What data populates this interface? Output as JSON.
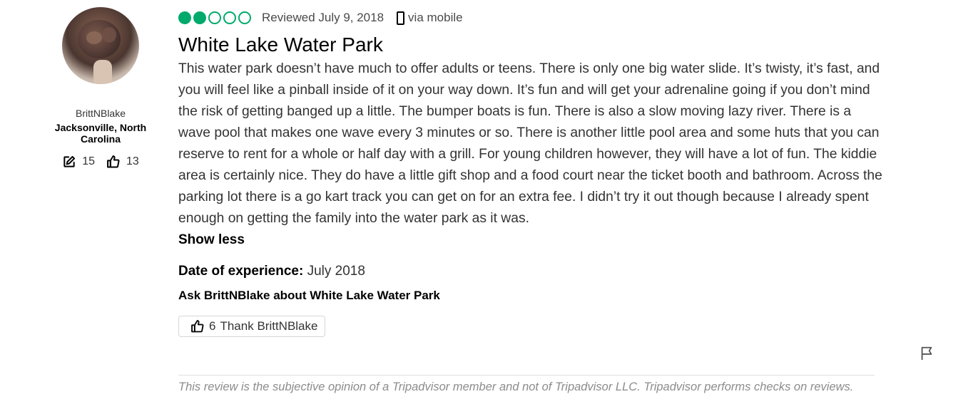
{
  "reviewer": {
    "username": "BrittNBlake",
    "location": "Jacksonville, North Carolina",
    "contributions": "15",
    "helpful_votes": "13"
  },
  "review": {
    "rating": 2,
    "rating_max": 5,
    "reviewed_date": "Reviewed July 9, 2018",
    "via": "via mobile",
    "title": "White Lake Water Park",
    "body": "This water park doesn’t have much to offer adults or teens. There is only one big water slide. It’s twisty, it’s fast, and you will feel like a pinball inside of it on your way down. It’s fun and will get your adrenaline going if you don’t mind the risk of getting banged up a little. The bumper boats is fun. There is also a slow moving lazy river. There is a wave pool that makes one wave every 3 minutes or so. There is another little pool area and some huts that you can reserve to rent for a whole or half day with a grill. For young children however, they will have a lot of fun. The kiddie area is certainly nice. They do have a little gift shop and a food court near the ticket booth and bathroom. Across the parking lot there is a go kart track you can get on for an extra fee. I didn’t try it out though because I already spent enough on getting the family into the water park as it was.",
    "show_less": "Show less",
    "date_label": "Date of experience:",
    "date_value": "July 2018",
    "ask": "Ask BrittNBlake about White Lake Water Park",
    "thank_count": "6",
    "thank_label": "Thank BrittNBlake",
    "disclaimer": "This review is the subjective opinion of a Tripadvisor member and not of Tripadvisor LLC. Tripadvisor performs checks on reviews."
  },
  "colors": {
    "bubble_green": "#00aa6c"
  },
  "icons": {
    "contributions": "edit-icon",
    "helpful": "thumbs-up-icon",
    "device": "mobile-phone-icon",
    "report": "flag-icon"
  }
}
